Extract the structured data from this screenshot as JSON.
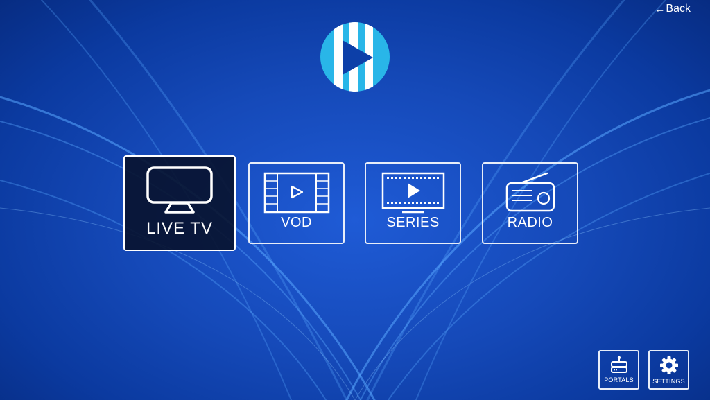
{
  "header": {
    "back_label": "Back",
    "back_icon": "left-arrow-icon"
  },
  "logo": {
    "icon": "play-logo-icon",
    "colors": {
      "circle": "#29b6e8",
      "stripes": "#ffffff",
      "play": "#0d3fa8"
    }
  },
  "menu": {
    "focused": "live-tv",
    "items": [
      {
        "id": "live-tv",
        "label": "LIVE TV",
        "icon": "tv-icon"
      },
      {
        "id": "vod",
        "label": "VOD",
        "icon": "film-icon"
      },
      {
        "id": "series",
        "label": "SERIES",
        "icon": "series-icon"
      },
      {
        "id": "radio",
        "label": "RADIO",
        "icon": "radio-icon"
      }
    ]
  },
  "footer": {
    "portals_label": "PORTALS",
    "portals_icon": "portals-icon",
    "settings_label": "SETTINGS",
    "settings_icon": "gear-icon"
  },
  "colors": {
    "background": "#1549b8",
    "tile_border": "#e8eef9",
    "focused_tile_bg": "#08122c"
  }
}
